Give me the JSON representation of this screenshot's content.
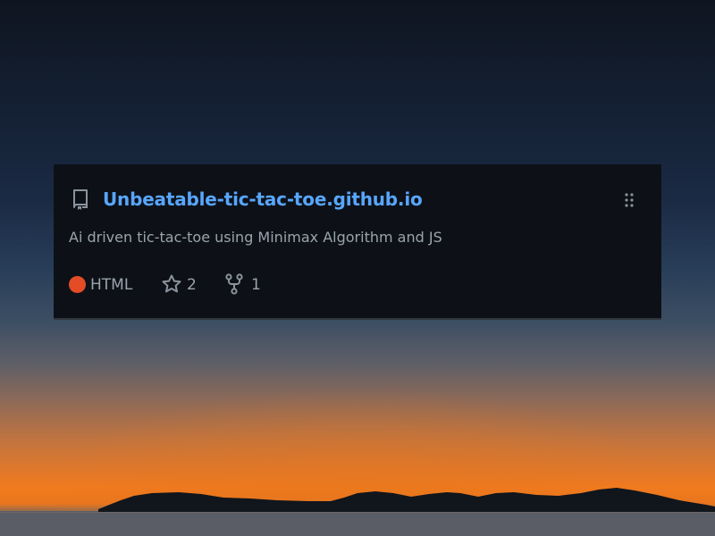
{
  "repo": {
    "name": "Unbeatable-tic-tac-toe.github.io",
    "description": "Ai driven tic-tac-toe using Minimax Algorithm and JS",
    "language": "HTML",
    "language_color": "#e34c26",
    "stars": "2",
    "forks": "1"
  },
  "icons": {
    "repo": "repo-icon",
    "drag": "drag-handle-icon",
    "star": "star-icon",
    "fork": "fork-icon"
  },
  "colors": {
    "card_background": "#0d1117",
    "link": "#58a6ff",
    "muted_text": "#9aa3ad"
  }
}
